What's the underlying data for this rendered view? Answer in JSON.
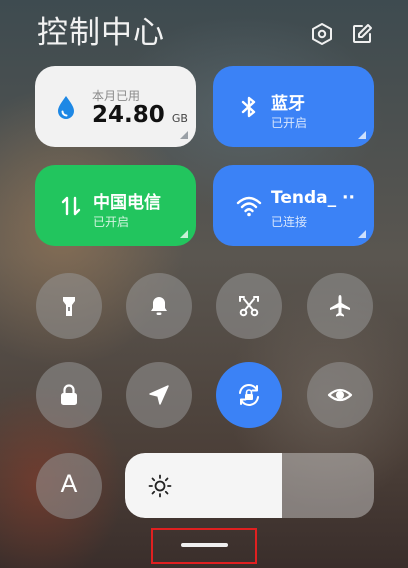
{
  "header": {
    "title": "控制中心",
    "settings_icon": "settings-hexagon-icon",
    "edit_icon": "edit-icon"
  },
  "tiles": {
    "data": {
      "label": "本月已用",
      "value": "24.80",
      "unit": "GB",
      "icon": "water-drop-icon",
      "accent": "#1e88e5"
    },
    "bluetooth": {
      "title": "蓝牙",
      "status": "已开启",
      "icon": "bluetooth-icon",
      "color": "#3b82f6"
    },
    "mobile": {
      "title": "中国电信",
      "status": "已开启",
      "icon": "data-transfer-icon",
      "color": "#22c55e"
    },
    "wifi": {
      "title": "Tenda_ ··",
      "status": "已连接",
      "icon": "wifi-icon",
      "color": "#3b82f6"
    }
  },
  "toggles": [
    {
      "name": "flashlight",
      "icon": "flashlight-icon",
      "active": false
    },
    {
      "name": "mute",
      "icon": "bell-icon",
      "active": false
    },
    {
      "name": "screenshot",
      "icon": "scissors-icon",
      "active": false
    },
    {
      "name": "airplane",
      "icon": "airplane-icon",
      "active": false
    },
    {
      "name": "lock",
      "icon": "lock-icon",
      "active": false
    },
    {
      "name": "location",
      "icon": "location-arrow-icon",
      "active": false
    },
    {
      "name": "rotation-lock",
      "icon": "rotation-lock-icon",
      "active": true
    },
    {
      "name": "eye-care",
      "icon": "eye-icon",
      "active": false
    },
    {
      "name": "font",
      "icon": "font-icon",
      "active": false
    }
  ],
  "font_button_label": "A",
  "brightness": {
    "level": 0.63,
    "icon": "sun-icon"
  },
  "colors": {
    "active": "#3b82f6",
    "green": "#22c55e",
    "highlight_box": "#e02020"
  }
}
